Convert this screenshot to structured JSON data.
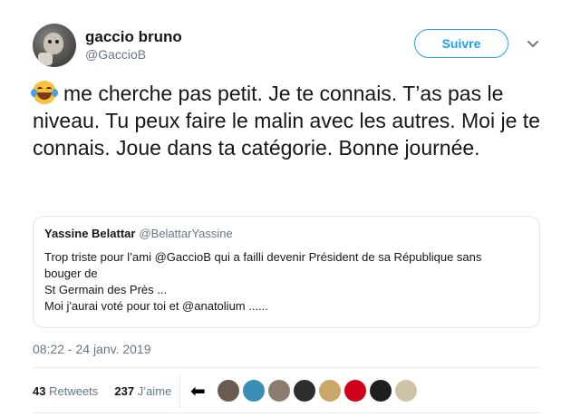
{
  "author": {
    "name": "gaccio bruno",
    "handle": "@GaccioB"
  },
  "follow": {
    "label": "Suivre"
  },
  "menu": {
    "icon": "chevron-down-icon"
  },
  "tweet": {
    "emoji": "face-with-tears-of-joy-emoji",
    "text": "me cherche pas petit. Je te connais. T’as pas le niveau. Tu peux faire le malin avec les autres.  Moi je te connais. Joue dans ta catégorie. Bonne journée."
  },
  "quoted": {
    "name": "Yassine Belattar",
    "handle": "@BelattarYassine",
    "lines": [
      "Trop triste pour l’ami @GaccioB qui a failli devenir Président de sa République sans",
      "bouger de",
      "St Germain des Près ...",
      "Moi j'aurai voté pour toi et @anatolium ......"
    ]
  },
  "timestamp": "08:22 - 24 janv. 2019",
  "stats": {
    "retweets_count": "43",
    "retweets_label": "Retweets",
    "likes_count": "237",
    "likes_label": "J’aime"
  },
  "likers": [
    {
      "icon": "liker-avatar",
      "color": "#6b5a4e"
    },
    {
      "icon": "liker-avatar",
      "color": "#3a8fb7"
    },
    {
      "icon": "liker-avatar",
      "color": "#8c7d6f"
    },
    {
      "icon": "liker-avatar",
      "color": "#2d2d2d"
    },
    {
      "icon": "liker-avatar",
      "color": "#c9a86a"
    },
    {
      "icon": "liker-avatar",
      "color": "#d0021b"
    },
    {
      "icon": "liker-avatar",
      "color": "#1f1f1f"
    },
    {
      "icon": "liker-avatar",
      "color": "#cfc3a5"
    }
  ]
}
